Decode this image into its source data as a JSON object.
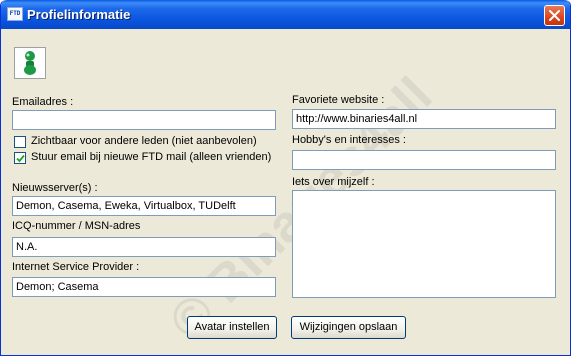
{
  "window": {
    "title": "Profielinformatie",
    "app_icon_text": "FTD"
  },
  "avatar": {
    "icon": "green-avatar-icon",
    "color": "#1e9a46"
  },
  "left": {
    "email_label": "Emailadres :",
    "email_value": "",
    "checkbox_visible_label": "Zichtbaar voor andere leden (niet aanbevolen)",
    "checkbox_visible_checked": false,
    "checkbox_mail_label": "Stuur email bij nieuwe FTD mail (alleen vrienden)",
    "checkbox_mail_checked": true,
    "newsservers_label": "Nieuwsserver(s) :",
    "newsservers_value": "Demon, Casema, Eweka, Virtualbox, TUDelft",
    "icq_label": "ICQ-nummer / MSN-adres",
    "icq_value": "N.A.",
    "isp_label": "Internet Service Provider :",
    "isp_value": "Demon; Casema"
  },
  "right": {
    "website_label": "Favoriete website :",
    "website_value": "http://www.binaries4all.nl",
    "hobbies_label": "Hobby's en interesses :",
    "hobbies_value": "",
    "about_label": "Iets over mijzelf :",
    "about_value": ""
  },
  "buttons": {
    "avatar_label": "Avatar instellen",
    "save_label": "Wijzigingen opslaan"
  },
  "watermark": "© Binaries4all"
}
